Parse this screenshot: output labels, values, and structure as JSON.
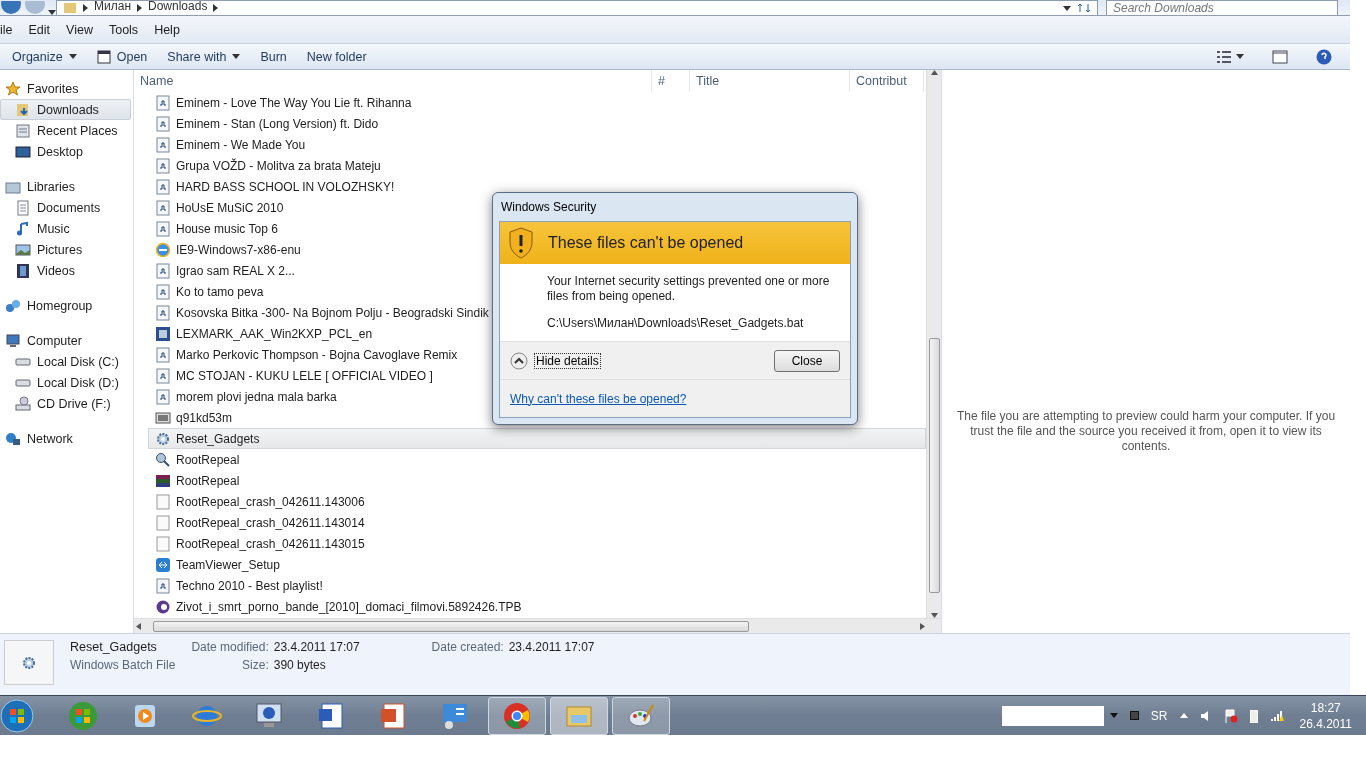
{
  "address_bar": {
    "path": [
      "Милан",
      "Downloads"
    ],
    "search": {
      "placeholder": "Search Downloads"
    }
  },
  "menu_bar": [
    "ile",
    "Edit",
    "View",
    "Tools",
    "Help"
  ],
  "toolbar": [
    {
      "label": "Organize",
      "kind": "dropdown"
    },
    {
      "label": "Open",
      "kind": "icon"
    },
    {
      "label": "Share with",
      "kind": "dropdown"
    },
    {
      "label": "Burn",
      "kind": "plain"
    },
    {
      "label": "New folder",
      "kind": "plain"
    }
  ],
  "navigation": [
    {
      "label": "Favorites",
      "kind": "star",
      "selected": false,
      "children": [
        {
          "label": "Downloads",
          "kind": "downloads",
          "selected": true
        },
        {
          "label": "Recent Places",
          "kind": "recent",
          "selected": false
        },
        {
          "label": "Desktop",
          "kind": "desktop",
          "selected": false
        }
      ]
    },
    {
      "label": "Libraries",
      "kind": "library",
      "selected": false,
      "children": [
        {
          "label": "Documents",
          "kind": "document",
          "selected": false
        },
        {
          "label": "Music",
          "kind": "music",
          "selected": false
        },
        {
          "label": "Pictures",
          "kind": "picture",
          "selected": false
        },
        {
          "label": "Videos",
          "kind": "video",
          "selected": false
        }
      ]
    },
    {
      "label": "Homegroup",
      "kind": "homegroup",
      "selected": false
    },
    {
      "label": "Computer",
      "kind": "computer",
      "selected": false,
      "children": [
        {
          "label": "Local Disk (C:)",
          "kind": "disk",
          "selected": false
        },
        {
          "label": "Local Disk (D:)",
          "kind": "disk",
          "selected": false
        },
        {
          "label": "CD Drive (F:)",
          "kind": "cd",
          "selected": false
        }
      ]
    },
    {
      "label": "Network",
      "kind": "network",
      "selected": false
    }
  ],
  "columns": [
    "Name",
    "#",
    "Title",
    "Contribut"
  ],
  "files": [
    {
      "name": "Eminem - Love The Way You Lie ft. Rihanna",
      "kind": "audio",
      "selected": false
    },
    {
      "name": "Eminem - Stan (Long Version) ft. Dido",
      "kind": "audio",
      "selected": false
    },
    {
      "name": "Eminem - We Made You",
      "kind": "audio",
      "selected": false
    },
    {
      "name": "Grupa VOŽD - Molitva za brata Mateju",
      "kind": "audio",
      "selected": false
    },
    {
      "name": "HARD BASS SCHOOL IN VOLOZHSKY!",
      "kind": "audio",
      "selected": false
    },
    {
      "name": "HoUsE MuSiC 2010",
      "kind": "audio",
      "selected": false
    },
    {
      "name": "House music Top 6",
      "kind": "audio",
      "selected": false
    },
    {
      "name": "IE9-Windows7-x86-enu",
      "kind": "web",
      "selected": false
    },
    {
      "name": "Igrao sam REAL X 2...",
      "kind": "audio",
      "selected": false
    },
    {
      "name": "Ko to tamo peva",
      "kind": "audio",
      "selected": false
    },
    {
      "name": "Kosovska Bitka -300- Na Bojnom Polju - Beogradski Sindik",
      "kind": "audio",
      "selected": false
    },
    {
      "name": "LEXMARK_AAK_Win2KXP_PCL_en",
      "kind": "setup",
      "selected": false
    },
    {
      "name": "Marko Perkovic Thompson - Bojna Cavoglave Remix",
      "kind": "audio",
      "selected": false
    },
    {
      "name": "MC STOJAN - KUKU LELE [ OFFICIAL VIDEO ]",
      "kind": "audio",
      "selected": false
    },
    {
      "name": "morem plovi jedna mala barka",
      "kind": "audio",
      "selected": false
    },
    {
      "name": "q91kd53m",
      "kind": "video",
      "selected": false
    },
    {
      "name": "Reset_Gadgets",
      "kind": "batch",
      "selected": true
    },
    {
      "name": "RootRepeal",
      "kind": "tool",
      "selected": false
    },
    {
      "name": "RootRepeal",
      "kind": "archive",
      "selected": false
    },
    {
      "name": "RootRepeal_crash_042611.143006",
      "kind": "text",
      "selected": false
    },
    {
      "name": "RootRepeal_crash_042611.143014",
      "kind": "text",
      "selected": false
    },
    {
      "name": "RootRepeal_crash_042611.143015",
      "kind": "text",
      "selected": false
    },
    {
      "name": "TeamViewer_Setup",
      "kind": "remote",
      "selected": false
    },
    {
      "name": "Techno 2010 - Best playlist!",
      "kind": "audio",
      "selected": false
    },
    {
      "name": "Zivot_i_smrt_porno_bande_[2010]_domaci_filmovi.5892426.TPB",
      "kind": "media",
      "selected": false
    }
  ],
  "preview": {
    "message": "The file you are attempting to preview could harm your computer. If you trust the file and the source you received it from, open it to view its contents."
  },
  "dialog": {
    "title": "Windows Security",
    "heading": "These files can't be opened",
    "message": "Your Internet security settings prevented one or more files from being opened.",
    "path": "C:\\Users\\Милан\\Downloads\\Reset_Gadgets.bat",
    "details_toggle": "Hide details",
    "button": "Close",
    "link": "Why can't these files be opened?"
  },
  "details": {
    "name": "Reset_Gadgets",
    "type": "Windows Batch File",
    "fields": [
      {
        "label": "Date modified:",
        "value": "23.4.2011 17:07"
      },
      {
        "label": "Size:",
        "value": "390 bytes"
      },
      {
        "label": "Date created:",
        "value": "23.4.2011 17:07"
      }
    ]
  },
  "taskbar": {
    "apps": [
      {
        "kind": "windows",
        "running": false,
        "selected": false
      },
      {
        "kind": "media",
        "running": false,
        "selected": false
      },
      {
        "kind": "ie",
        "running": false,
        "selected": false
      },
      {
        "kind": "info",
        "running": false,
        "selected": false
      },
      {
        "kind": "word",
        "running": false,
        "selected": false
      },
      {
        "kind": "slides",
        "running": false,
        "selected": false
      },
      {
        "kind": "panel",
        "running": false,
        "selected": false
      },
      {
        "kind": "chrome",
        "running": true,
        "selected": false
      },
      {
        "kind": "folder",
        "running": true,
        "selected": true
      },
      {
        "kind": "paint",
        "running": true,
        "selected": false
      }
    ],
    "language": "SR",
    "time": "18:27",
    "date": "26.4.2011"
  }
}
